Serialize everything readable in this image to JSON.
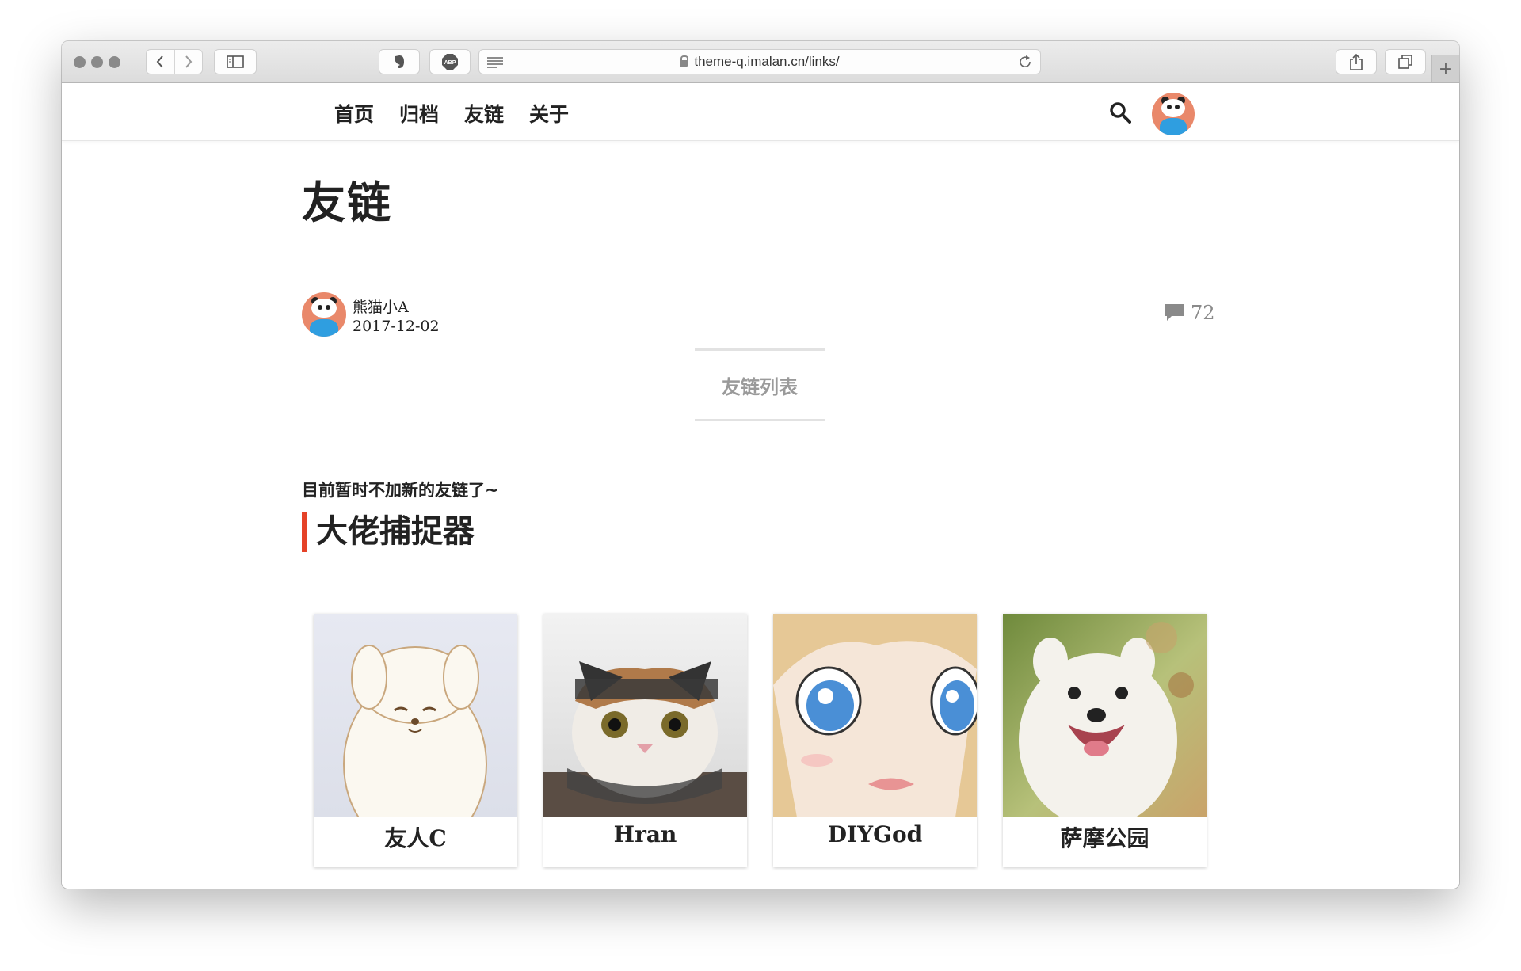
{
  "browser": {
    "url": "theme-q.imalan.cn/links/",
    "new_tab_symbol": "+"
  },
  "site": {
    "nav": [
      {
        "label": "首页"
      },
      {
        "label": "归档"
      },
      {
        "label": "友链"
      },
      {
        "label": "关于"
      }
    ]
  },
  "post": {
    "title": "友链",
    "author": "熊猫小A",
    "date": "2017-12-02",
    "comment_count": "72",
    "toc_label": "友链列表",
    "notice": "目前暂时不加新的友链了~",
    "section_title": "大佬捕捉器",
    "accent_color": "#e54228"
  },
  "friends": [
    {
      "name": "友人C"
    },
    {
      "name": "Hran"
    },
    {
      "name": "DIYGod"
    },
    {
      "name": "萨摩公园"
    }
  ]
}
